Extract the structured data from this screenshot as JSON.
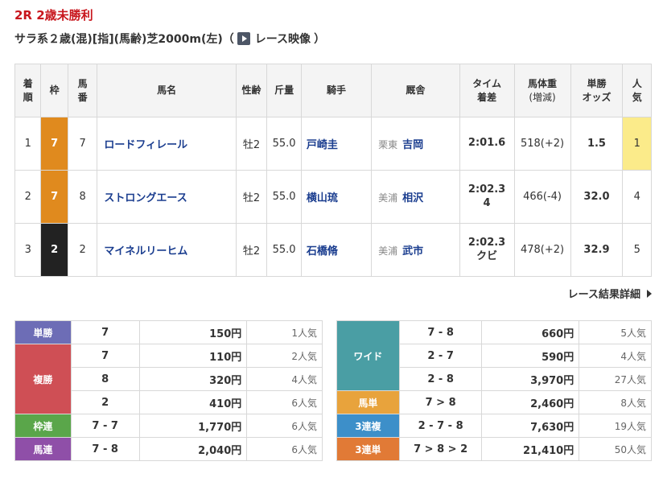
{
  "race": {
    "title": "2R 2歳未勝利",
    "conditions": "サラ系２歳(混)[指](馬齢)芝2000m(左)（",
    "video_label": "レース映像",
    "close_paren": "）"
  },
  "result_headers": {
    "rank": [
      "着",
      "順"
    ],
    "waku": "枠",
    "umaban": [
      "馬",
      "番"
    ],
    "name": "馬名",
    "sex_age": "性齢",
    "weight_carried": "斤量",
    "jockey": "騎手",
    "trainer": "厩舎",
    "time": [
      "タイム",
      "着差"
    ],
    "body_weight": [
      "馬体重",
      "(増減)"
    ],
    "odds": [
      "単勝",
      "オッズ"
    ],
    "popularity": [
      "人",
      "気"
    ]
  },
  "results": [
    {
      "rank": "1",
      "waku": "7",
      "umaban": "7",
      "name": "ロードフィレール",
      "sex_age": "牡2",
      "weight": "55.0",
      "jockey": "戸崎圭",
      "stable": "栗東",
      "trainer": "吉岡",
      "time": "2:01.6",
      "margin": "",
      "body_weight": "518(+2)",
      "odds": "1.5",
      "popularity": "1"
    },
    {
      "rank": "2",
      "waku": "7",
      "umaban": "8",
      "name": "ストロングエース",
      "sex_age": "牡2",
      "weight": "55.0",
      "jockey": "横山琉",
      "stable": "美浦",
      "trainer": "相沢",
      "time": "2:02.3",
      "margin": "4",
      "body_weight": "466(-4)",
      "odds": "32.0",
      "popularity": "4"
    },
    {
      "rank": "3",
      "waku": "2",
      "umaban": "2",
      "name": "マイネルリーヒム",
      "sex_age": "牡2",
      "weight": "55.0",
      "jockey": "石橋脩",
      "stable": "美浦",
      "trainer": "武市",
      "time": "2:02.3",
      "margin": "クビ",
      "body_weight": "478(+2)",
      "odds": "32.9",
      "popularity": "5"
    }
  ],
  "detail_link": "レース結果詳細",
  "payouts_left": {
    "tansho": {
      "label": "単勝",
      "rows": [
        {
          "combo": "7",
          "amount": "150円",
          "pop": "1人気"
        }
      ]
    },
    "fukusho": {
      "label": "複勝",
      "rows": [
        {
          "combo": "7",
          "amount": "110円",
          "pop": "2人気"
        },
        {
          "combo": "8",
          "amount": "320円",
          "pop": "4人気"
        },
        {
          "combo": "2",
          "amount": "410円",
          "pop": "6人気"
        }
      ]
    },
    "wakuren": {
      "label": "枠連",
      "rows": [
        {
          "combo": "7 - 7",
          "amount": "1,770円",
          "pop": "6人気"
        }
      ]
    },
    "umaren": {
      "label": "馬連",
      "rows": [
        {
          "combo": "7 - 8",
          "amount": "2,040円",
          "pop": "6人気"
        }
      ]
    }
  },
  "payouts_right": {
    "wide": {
      "label": "ワイド",
      "rows": [
        {
          "combo": "7 - 8",
          "amount": "660円",
          "pop": "5人気"
        },
        {
          "combo": "2 - 7",
          "amount": "590円",
          "pop": "4人気"
        },
        {
          "combo": "2 - 8",
          "amount": "3,970円",
          "pop": "27人気"
        }
      ]
    },
    "umatan": {
      "label": "馬単",
      "rows": [
        {
          "combo": "7 > 8",
          "amount": "2,460円",
          "pop": "8人気"
        }
      ]
    },
    "sanrenpuku": {
      "label": "3連複",
      "rows": [
        {
          "combo": "2 - 7 - 8",
          "amount": "7,630円",
          "pop": "19人気"
        }
      ]
    },
    "sanrentan": {
      "label": "3連単",
      "rows": [
        {
          "combo": "7 > 8 > 2",
          "amount": "21,410円",
          "pop": "50人気"
        }
      ]
    }
  }
}
